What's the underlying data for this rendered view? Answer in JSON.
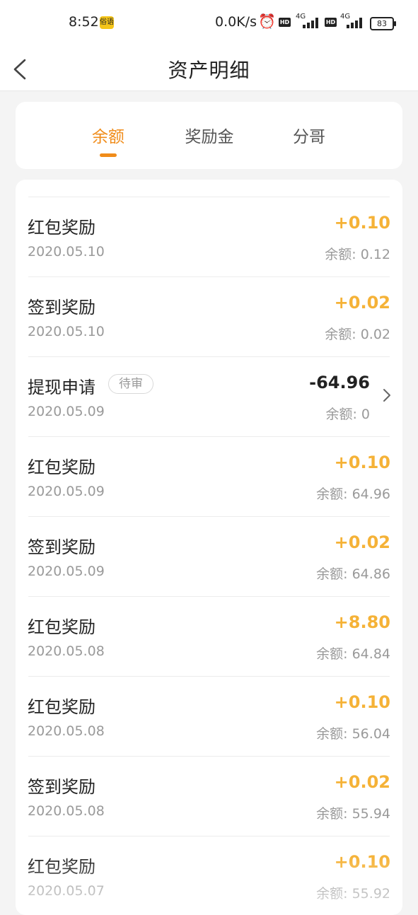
{
  "status_bar": {
    "time": "8:52",
    "app_icon_text": "俗语",
    "net_speed": "0.0K/s",
    "alarm_icon": "alarm-icon",
    "hd_label": "HD",
    "net_type_1": "4G",
    "net_type_2": "4G",
    "battery": "83"
  },
  "header": {
    "title": "资产明细",
    "back_icon": "chevron-left-icon"
  },
  "tabs": [
    {
      "label": "余额",
      "active": true
    },
    {
      "label": "奖励金",
      "active": false
    },
    {
      "label": "分哥",
      "active": false
    }
  ],
  "colors": {
    "accent": "#f08c1a",
    "income": "#f5b237",
    "expense": "#222222",
    "muted": "#9a9a9a"
  },
  "transactions": [
    {
      "title": "红包奖励",
      "date": "2020.05.10",
      "amount": "+0.10",
      "balance": "余额: 0.12"
    },
    {
      "title": "签到奖励",
      "date": "2020.05.10",
      "amount": "+0.02",
      "balance": "余额: 0.02"
    },
    {
      "title": "提现申请",
      "badge": "待审",
      "date": "2020.05.09",
      "amount": "-64.96",
      "balance": "余额: 0"
    },
    {
      "title": "红包奖励",
      "date": "2020.05.09",
      "amount": "+0.10",
      "balance": "余额: 64.96"
    },
    {
      "title": "签到奖励",
      "date": "2020.05.09",
      "amount": "+0.02",
      "balance": "余额: 64.86"
    },
    {
      "title": "红包奖励",
      "date": "2020.05.08",
      "amount": "+8.80",
      "balance": "余额: 64.84"
    },
    {
      "title": "红包奖励",
      "date": "2020.05.08",
      "amount": "+0.10",
      "balance": "余额: 56.04"
    },
    {
      "title": "签到奖励",
      "date": "2020.05.08",
      "amount": "+0.02",
      "balance": "余额: 55.94"
    },
    {
      "title": "红包奖励",
      "date": "2020.05.07",
      "amount": "+0.10",
      "balance": "余额: 55.92"
    }
  ]
}
